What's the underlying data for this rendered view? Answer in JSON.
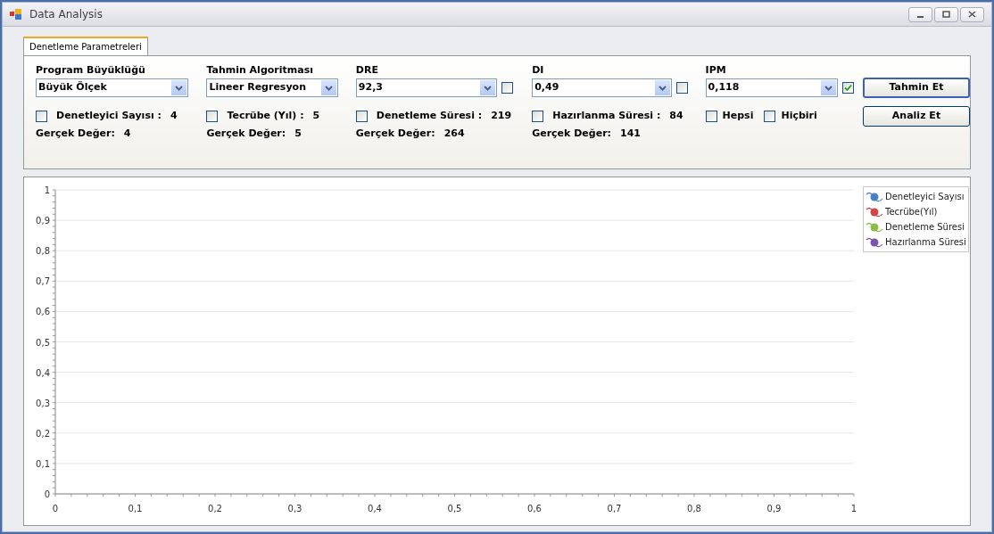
{
  "window": {
    "title": "Data Analysis"
  },
  "tabs": [
    {
      "label": "Denetleme Parametreleri",
      "selected": true
    }
  ],
  "parameters": [
    {
      "label": "Program Büyüklüğü",
      "value": "Büyük Ölçek",
      "metric": {
        "label": "Denetleyici Sayısı :",
        "value": "4",
        "checked": false
      },
      "actual": {
        "label": "Gerçek Değer:",
        "value": "4"
      }
    },
    {
      "label": "Tahmin Algoritması",
      "value": "Lineer Regresyon",
      "metric": {
        "label": "Tecrübe (Yıl) :",
        "value": "5",
        "checked": false
      },
      "actual": {
        "label": "Gerçek Değer:",
        "value": "5"
      }
    },
    {
      "label": "DRE",
      "value": "92,3",
      "checked": false,
      "metric": {
        "label": "Denetleme Süresi :",
        "value": "219",
        "checked": false
      },
      "actual": {
        "label": "Gerçek Değer:",
        "value": "264"
      }
    },
    {
      "label": "DI",
      "value": "0,49",
      "checked": false,
      "metric": {
        "label": "Hazırlanma Süresi :",
        "value": "84",
        "checked": false
      },
      "actual": {
        "label": "Gerçek Değer:",
        "value": "141"
      }
    },
    {
      "label": "IPM",
      "value": "0,118",
      "checked": true,
      "options": [
        {
          "label": "Hepsi",
          "checked": false
        },
        {
          "label": "Hiçbiri",
          "checked": false
        }
      ]
    }
  ],
  "buttons": [
    "Tahmin Et",
    "Analiz Et"
  ],
  "chart": {
    "legend": [
      {
        "name": "Denetleyici Sayısı",
        "color": "#4a7fc8"
      },
      {
        "name": "Tecrübe(Yıl)",
        "color": "#d04545"
      },
      {
        "name": "Denetleme Süresi",
        "color": "#8cbc44"
      },
      {
        "name": "Hazırlanma Süresi",
        "color": "#7a55a8"
      }
    ],
    "chart_data": {
      "type": "line",
      "grid": true,
      "xlim": [
        0,
        1
      ],
      "ylim": [
        0,
        1
      ],
      "xticks": [
        0,
        {
          "value": 0.1,
          "label": "0,1"
        },
        {
          "value": 0.2,
          "label": "0,2"
        },
        {
          "value": 0.3,
          "label": "0,3"
        },
        {
          "value": 0.4,
          "label": "0,4"
        },
        {
          "value": 0.5,
          "label": "0,5"
        },
        {
          "value": 0.6,
          "label": "0,6"
        },
        {
          "value": 0.7,
          "label": "0,7"
        },
        {
          "value": 0.8,
          "label": "0,8"
        },
        {
          "value": 0.9,
          "label": "0,9"
        },
        1
      ],
      "yticks": [
        0,
        {
          "value": 0.1,
          "label": "0,1"
        },
        {
          "value": 0.2,
          "label": "0,2"
        },
        {
          "value": 0.3,
          "label": "0,3"
        },
        {
          "value": 0.4,
          "label": "0,4"
        },
        {
          "value": 0.5,
          "label": "0,5"
        },
        {
          "value": 0.6,
          "label": "0,6"
        },
        {
          "value": 0.7,
          "label": "0,7"
        },
        {
          "value": 0.8,
          "label": "0,8"
        },
        {
          "value": 0.9,
          "label": "0,9"
        },
        1
      ]
    }
  }
}
